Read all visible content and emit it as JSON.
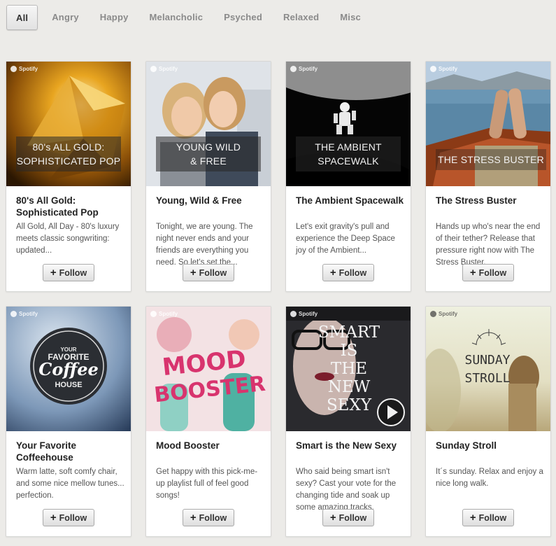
{
  "tabs": [
    "All",
    "Angry",
    "Happy",
    "Melancholic",
    "Psyched",
    "Relaxed",
    "Misc"
  ],
  "brand": "Spotify",
  "follow_label": "Follow",
  "cards": [
    {
      "cover": "80's ALL GOLD:\nSOPHISTICATED POP",
      "title": "80's All Gold: Sophisticated Pop",
      "desc": "All Gold, All Day - 80's luxury meets classic songwriting: updated..."
    },
    {
      "cover": "YOUNG WILD\n& FREE",
      "title": "Young, Wild & Free",
      "desc": "Tonight, we are young. The night never ends and your friends are everything you need. So let's set the..."
    },
    {
      "cover": "THE AMBIENT\nSPACEWALK",
      "title": "The Ambient Spacewalk",
      "desc": "Let's exit gravity's pull and experience the Deep Space joy of the Ambient..."
    },
    {
      "cover": "THE STRESS BUSTER",
      "title": "The Stress Buster",
      "desc": "Hands up who's near the end of their tether? Release that pressure right now with The Stress Buster."
    },
    {
      "cover": "YOUR FAVORITE Coffee HOUSE",
      "title": "Your Favorite Coffeehouse",
      "desc": "Warm latte, soft comfy chair, and some nice mellow tunes... perfection."
    },
    {
      "cover": "MOOD BOOSTER",
      "title": "Mood Booster",
      "desc": "Get happy with this pick-me-up playlist full of feel good songs!"
    },
    {
      "cover": "SMART IS THE NEW SEXY",
      "title": "Smart is the New Sexy",
      "desc": "Who said being smart isn't sexy? Cast your vote for the changing tide and soak up some amazing tracks."
    },
    {
      "cover": "SUNDAY STROLL",
      "title": "Sunday Stroll",
      "desc": "It´s sunday. Relax and enjoy a nice long walk."
    }
  ],
  "colors": {
    "background": "#ecebe8",
    "card": "#ffffff",
    "title": "#222222",
    "desc": "#555555"
  }
}
